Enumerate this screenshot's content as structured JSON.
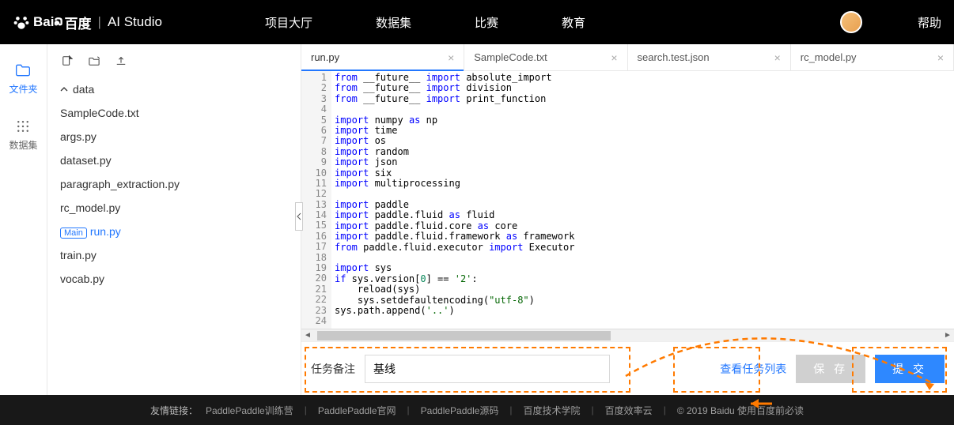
{
  "header": {
    "logo_text": "百度",
    "studio_text": "AI Studio",
    "nav": {
      "hall": "项目大厅",
      "datasets": "数据集",
      "competitions": "比赛",
      "education": "教育"
    },
    "help": "帮助"
  },
  "sidebar": {
    "files": "文件夹",
    "datasets": "数据集"
  },
  "tree": {
    "folder": "data",
    "items": [
      "SampleCode.txt",
      "args.py",
      "dataset.py",
      "paragraph_extraction.py",
      "rc_model.py",
      "run.py",
      "train.py",
      "vocab.py"
    ],
    "main_badge": "Main"
  },
  "tabs": [
    {
      "name": "run.py",
      "active": true
    },
    {
      "name": "SampleCode.txt"
    },
    {
      "name": "search.test.json"
    },
    {
      "name": "rc_model.py"
    }
  ],
  "code_lines": 24,
  "bottom": {
    "label": "任务备注",
    "value": "基线",
    "view_tasks": "查看任务列表",
    "save": "保 存",
    "submit": "提 交"
  },
  "footer": {
    "label": "友情链接：",
    "links": [
      "PaddlePaddle训练营",
      "PaddlePaddle官网",
      "PaddlePaddle源码",
      "百度技术学院",
      "百度效率云"
    ],
    "copyright": "© 2019 Baidu 使用百度前必读"
  }
}
